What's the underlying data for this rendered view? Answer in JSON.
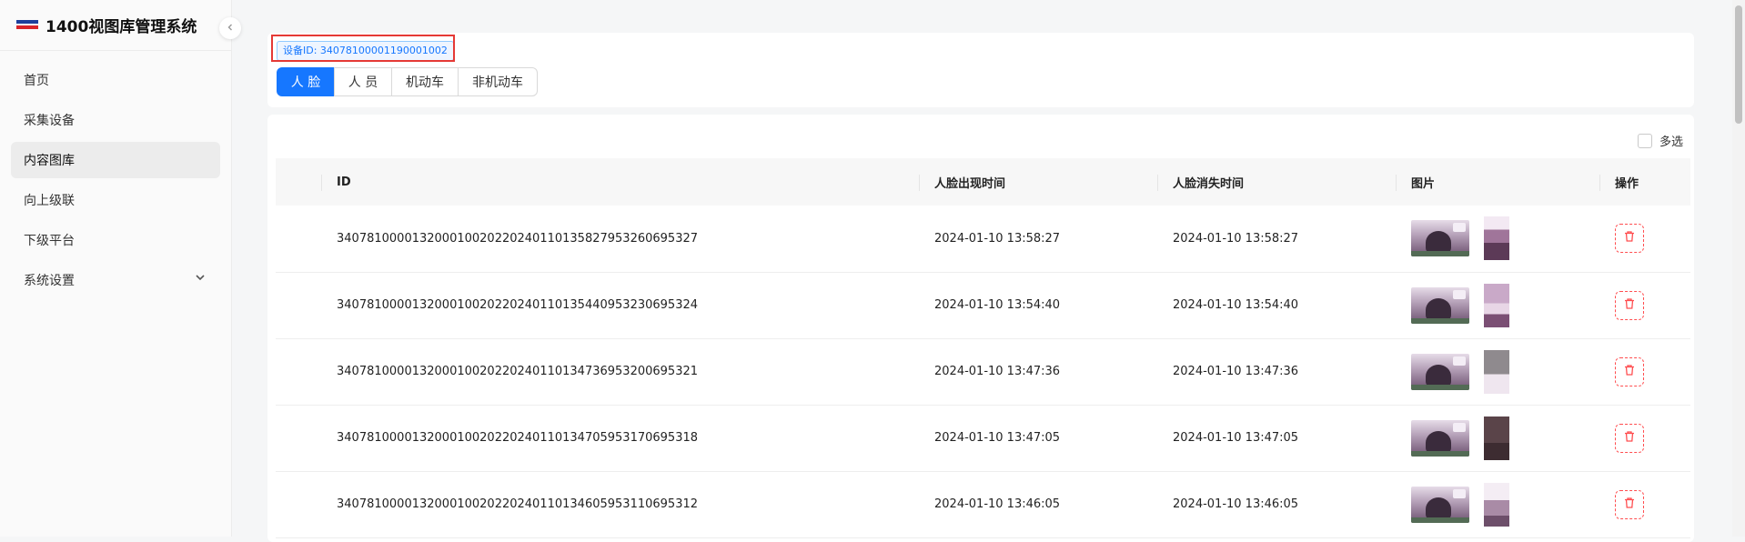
{
  "brand": {
    "title": "1400视图库管理系统",
    "logo_colors": [
      "#1d3f9c",
      "#d8242a"
    ]
  },
  "sidebar": {
    "items": [
      {
        "label": "首页",
        "active": false
      },
      {
        "label": "采集设备",
        "active": false
      },
      {
        "label": "内容图库",
        "active": true
      },
      {
        "label": "向上级联",
        "active": false
      },
      {
        "label": "下级平台",
        "active": false
      },
      {
        "label": "系统设置",
        "active": false,
        "has_submenu": true
      }
    ]
  },
  "filter": {
    "device_tag": "设备ID: 34078100001190001002",
    "tabs": [
      "人 脸",
      "人 员",
      "机动车",
      "非机动车"
    ],
    "active_tab": 0
  },
  "table": {
    "multi_select_label": "多选",
    "columns": [
      "ID",
      "人脸出现时间",
      "人脸消失时间",
      "图片",
      "操作"
    ],
    "rows": [
      {
        "id": "34078100001320001002022024011013582795326069532​7",
        "appear": "2024-01-10 13:58:27",
        "disappear": "2024-01-10 13:58:27"
      },
      {
        "id": "34078100001320001002022024011013544095323069532​4",
        "appear": "2024-01-10 13:54:40",
        "disappear": "2024-01-10 13:54:40"
      },
      {
        "id": "34078100001320001002022024011013473695320069532​1",
        "appear": "2024-01-10 13:47:36",
        "disappear": "2024-01-10 13:47:36"
      },
      {
        "id": "34078100001320001002022024011013470595317069531​8",
        "appear": "2024-01-10 13:47:05",
        "disappear": "2024-01-10 13:47:05"
      },
      {
        "id": "34078100001320001002022024011013460595311069531​2",
        "appear": "2024-01-10 13:46:05",
        "disappear": "2024-01-10 13:46:05"
      }
    ]
  },
  "colors": {
    "primary": "#1677ff",
    "danger": "#ff4d4f",
    "highlight": "#e53935"
  }
}
